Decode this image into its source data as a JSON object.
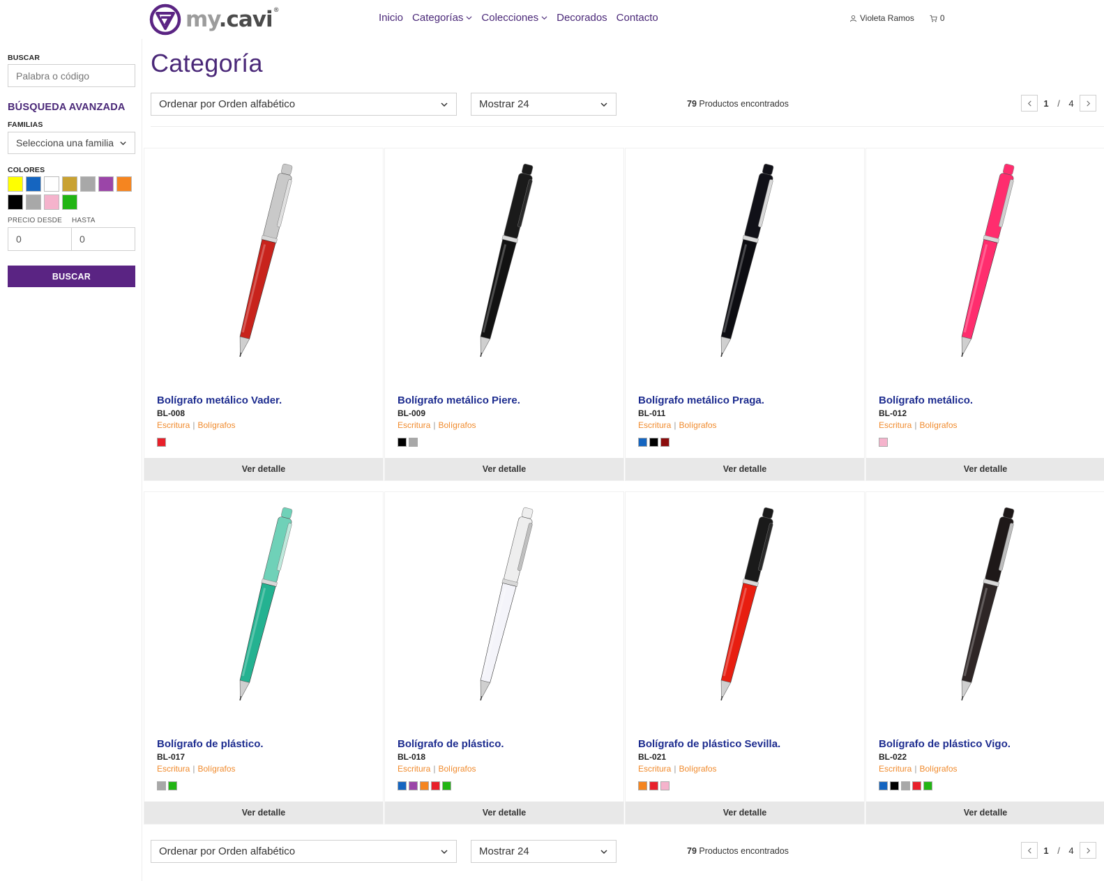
{
  "header": {
    "logo_text_my": "my",
    "logo_text_cavi": ".cavi",
    "logo_reg": "®",
    "nav": [
      {
        "label": "Inicio",
        "dropdown": false
      },
      {
        "label": "Categorías",
        "dropdown": true
      },
      {
        "label": "Colecciones",
        "dropdown": true
      },
      {
        "label": "Decorados",
        "dropdown": false
      },
      {
        "label": "Contacto",
        "dropdown": false
      }
    ],
    "user_name": "Violeta Ramos",
    "cart_count": "0",
    "brand_color": "#4a2878"
  },
  "sidebar": {
    "search_label": "BUSCAR",
    "search_placeholder": "Palabra o código",
    "advanced_heading": "BÚSQUEDA AVANZADA",
    "families_label": "FAMILIAS",
    "families_value": "Selecciona una familia",
    "colors_label": "COLORES",
    "colors": [
      "#ffff00",
      "#1565c0",
      "#ffffff",
      "#c9a232",
      "#a8a8a8",
      "#9b45a8",
      "#f58520",
      "#000000",
      "#a8a8a8",
      "#f5b3cc",
      "#22b514"
    ],
    "price_from_label": "PRECIO DESDE",
    "price_to_label": "HASTA",
    "price_from": "0",
    "price_to": "0",
    "search_button": "BUSCAR",
    "button_color": "#5a2483"
  },
  "main": {
    "title": "Categoría",
    "sort_label": "Ordenar por Orden alfabético",
    "show_label": "Mostrar 24",
    "count": "79",
    "count_text": " Productos encontrados",
    "page_current": "1",
    "page_sep": "/",
    "page_total": "4"
  },
  "products": [
    {
      "name": "Bolígrafo metálico Vader.",
      "code": "BL-008",
      "cat1": "Escritura",
      "cat2": "Bolígrafos",
      "colors": [
        "#e8202a"
      ],
      "button": "Ver detalle",
      "pen": {
        "body": "#c8231c",
        "cap": "#c9c9c9",
        "clip": "#e0e0e0"
      }
    },
    {
      "name": "Bolígrafo metálico Piere.",
      "code": "BL-009",
      "cat1": "Escritura",
      "cat2": "Bolígrafos",
      "colors": [
        "#000000",
        "#a8a8a8"
      ],
      "button": "Ver detalle",
      "pen": {
        "body": "#121212",
        "cap": "#1a1a1a",
        "clip": "#2a2a2a"
      }
    },
    {
      "name": "Bolígrafo metálico Praga.",
      "code": "BL-011",
      "cat1": "Escritura",
      "cat2": "Bolígrafos",
      "colors": [
        "#1565c0",
        "#000000",
        "#8b0d0d"
      ],
      "button": "Ver detalle",
      "pen": {
        "body": "#0d0d12",
        "cap": "#111118",
        "clip": "#d9d9d9"
      }
    },
    {
      "name": "Bolígrafo metálico.",
      "code": "BL-012",
      "cat1": "Escritura",
      "cat2": "Bolígrafos",
      "colors": [
        "#f5b3cc"
      ],
      "button": "Ver detalle",
      "pen": {
        "body": "#ff2d6e",
        "cap": "#ff2d6e",
        "clip": "#d0d0d0"
      }
    },
    {
      "name": "Bolígrafo de plástico.",
      "code": "BL-017",
      "cat1": "Escritura",
      "cat2": "Bolígrafos",
      "colors": [
        "#a8a8a8",
        "#22b514"
      ],
      "button": "Ver detalle",
      "pen": {
        "body": "#24b291",
        "cap": "#6fd1b8",
        "clip": "#bfe9dc"
      }
    },
    {
      "name": "Bolígrafo de plástico.",
      "code": "BL-018",
      "cat1": "Escritura",
      "cat2": "Bolígrafos",
      "colors": [
        "#1565c0",
        "#9b45a8",
        "#f58520",
        "#e8202a",
        "#22b514"
      ],
      "button": "Ver detalle",
      "pen": {
        "body": "#f4f4fa",
        "cap": "#eeeeee",
        "clip": "#c0c0c0"
      }
    },
    {
      "name": "Bolígrafo de plástico Sevilla.",
      "code": "BL-021",
      "cat1": "Escritura",
      "cat2": "Bolígrafos",
      "colors": [
        "#f58520",
        "#e8202a",
        "#f5b3cc"
      ],
      "button": "Ver detalle",
      "pen": {
        "body": "#e81e10",
        "cap": "#1a1a1a",
        "clip": "#2a2a2a"
      }
    },
    {
      "name": "Bolígrafo de plástico Vigo.",
      "code": "BL-022",
      "cat1": "Escritura",
      "cat2": "Bolígrafos",
      "colors": [
        "#1565c0",
        "#000000",
        "#a8a8a8",
        "#e8202a",
        "#22b514"
      ],
      "button": "Ver detalle",
      "pen": {
        "body": "#2e2626",
        "cap": "#1e1818",
        "clip": "#bdbdbd"
      }
    }
  ]
}
